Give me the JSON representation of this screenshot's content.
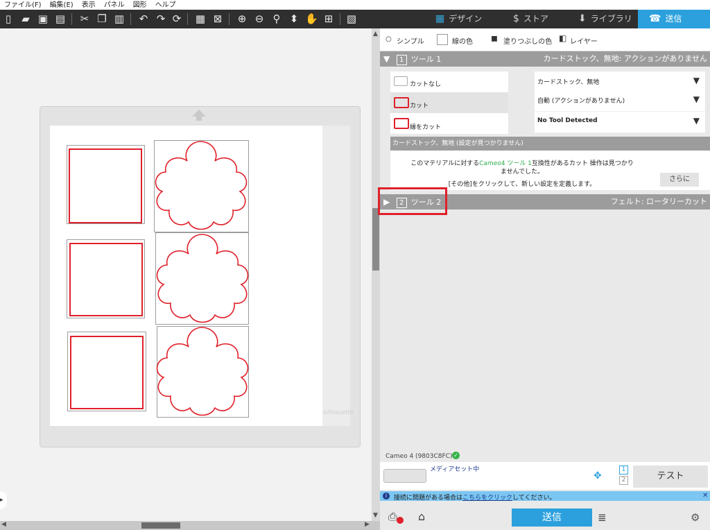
{
  "menu": [
    "ファイル(F)",
    "編集(E)",
    "表示",
    "パネル",
    "図形",
    "ヘルプ"
  ],
  "tabs": {
    "design": "デザイン",
    "store": "ストア",
    "library": "ライブラリ",
    "send": "送信"
  },
  "subtabs": {
    "simple": "シンプル",
    "line_color": "線の色",
    "fill_color": "塗りつぶしの色",
    "layer": "レイヤー"
  },
  "tool1": {
    "number": "1",
    "label": "ツール 1",
    "summary": "カードストック、無地: アクションがありません",
    "options": [
      "カットなし",
      "カット",
      "縁をカット"
    ],
    "material": "カードストック、無地",
    "action": "自動 (アクションがありません)",
    "tool": "No Tool Detected",
    "settings_header": "カードストック、無地 (設定が見つかりません)",
    "msg_prefix": "このマテリアルに対する",
    "msg_highlight": "Cameo4 ツール 1",
    "msg_suffix": "互換性があるカット 操作は見つかり",
    "msg_line2": "ませんでした。",
    "msg_line3": "[その他]をクリックして、新しい設定を定義します。",
    "more_button": "さらに"
  },
  "tool2": {
    "number": "2",
    "label": "ツール 2",
    "summary": "フェルト: ロータリーカット"
  },
  "device": {
    "name": "Cameo 4 (9803C8FC)",
    "status": "メディアセット中",
    "tool_numbers": [
      "1",
      "2"
    ],
    "test_button": "テスト"
  },
  "connection_notice": {
    "prefix": "接続に問題がある場合は",
    "link": "こちらをクリック",
    "suffix": "してください。"
  },
  "send_button": "送信",
  "watermark": "silhouette",
  "colors": {
    "accent": "#2ba0dd",
    "cut_line": "#e0202a",
    "highlight_box": "#e0202a",
    "status_bar": "#7cc6f2"
  }
}
